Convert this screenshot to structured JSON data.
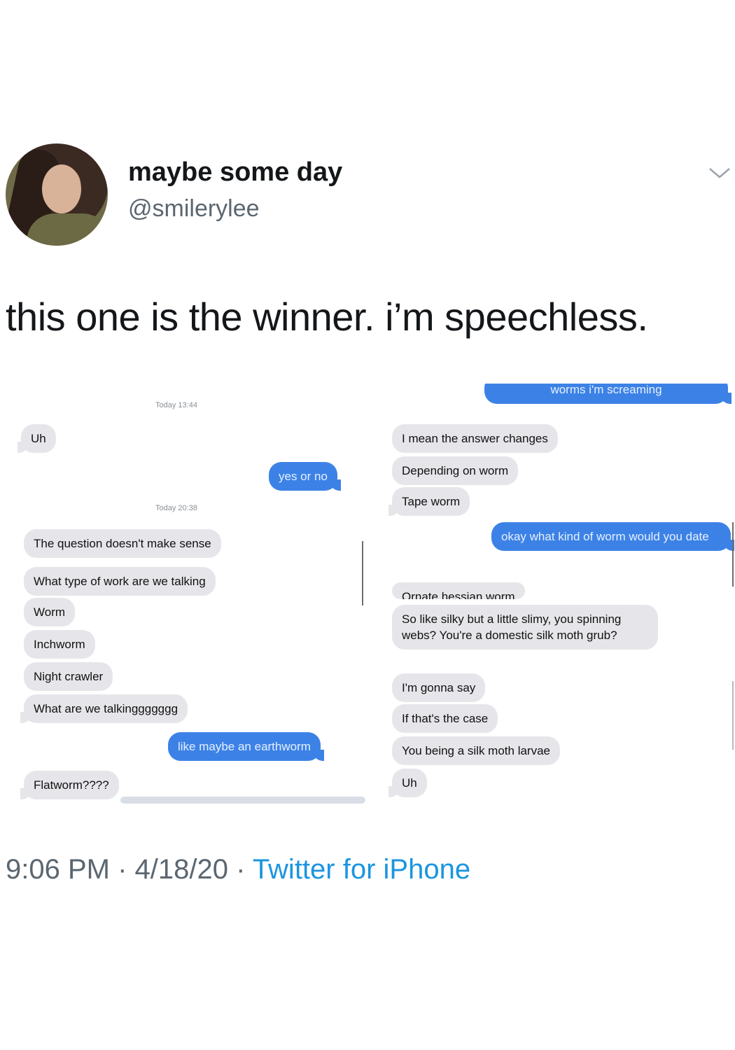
{
  "tweet": {
    "display_name": "maybe some day",
    "handle": "@smilerylee",
    "text": "this one is the winner. i’m speechless.",
    "time": "9:06 PM",
    "separator1": " · ",
    "date": "4/18/20",
    "separator2": " · ",
    "source": "Twitter for iPhone",
    "icons": {
      "menu": "chevron-down-icon",
      "avatar": "profile-photo"
    }
  },
  "screenshot_left": {
    "timestamp1": "Today 13:44",
    "timestamp2": "Today 20:38",
    "messages": [
      {
        "from": "them",
        "text": "Uh"
      },
      {
        "from": "me",
        "text": "yes or no"
      },
      {
        "from": "them",
        "text": "The question doesn't make sense"
      },
      {
        "from": "them",
        "text": "What type of work are we talking"
      },
      {
        "from": "them",
        "text": "Worm"
      },
      {
        "from": "them",
        "text": "Inchworm"
      },
      {
        "from": "them",
        "text": "Night crawler"
      },
      {
        "from": "them",
        "text": "What are we talkinggggggg"
      },
      {
        "from": "me",
        "text": "like maybe an earthworm"
      },
      {
        "from": "them",
        "text": "Flatworm????"
      }
    ]
  },
  "screenshot_right": {
    "messages": [
      {
        "from": "me",
        "text": "worms i'm screaming"
      },
      {
        "from": "them",
        "text": "I mean the answer changes"
      },
      {
        "from": "them",
        "text": "Depending on worm"
      },
      {
        "from": "them",
        "text": "Tape worm"
      },
      {
        "from": "me",
        "text": "okay what kind of worm would you date"
      },
      {
        "from": "them",
        "text": "Ornate hessian worm"
      },
      {
        "from": "them",
        "text": "So like silky but a little slimy, you spinning webs? You're a domestic silk moth grub?"
      },
      {
        "from": "them",
        "text": "I'm gonna say"
      },
      {
        "from": "them",
        "text": "If that's the case"
      },
      {
        "from": "them",
        "text": "You being a silk moth larvae"
      },
      {
        "from": "them",
        "text": "Uh"
      }
    ]
  }
}
